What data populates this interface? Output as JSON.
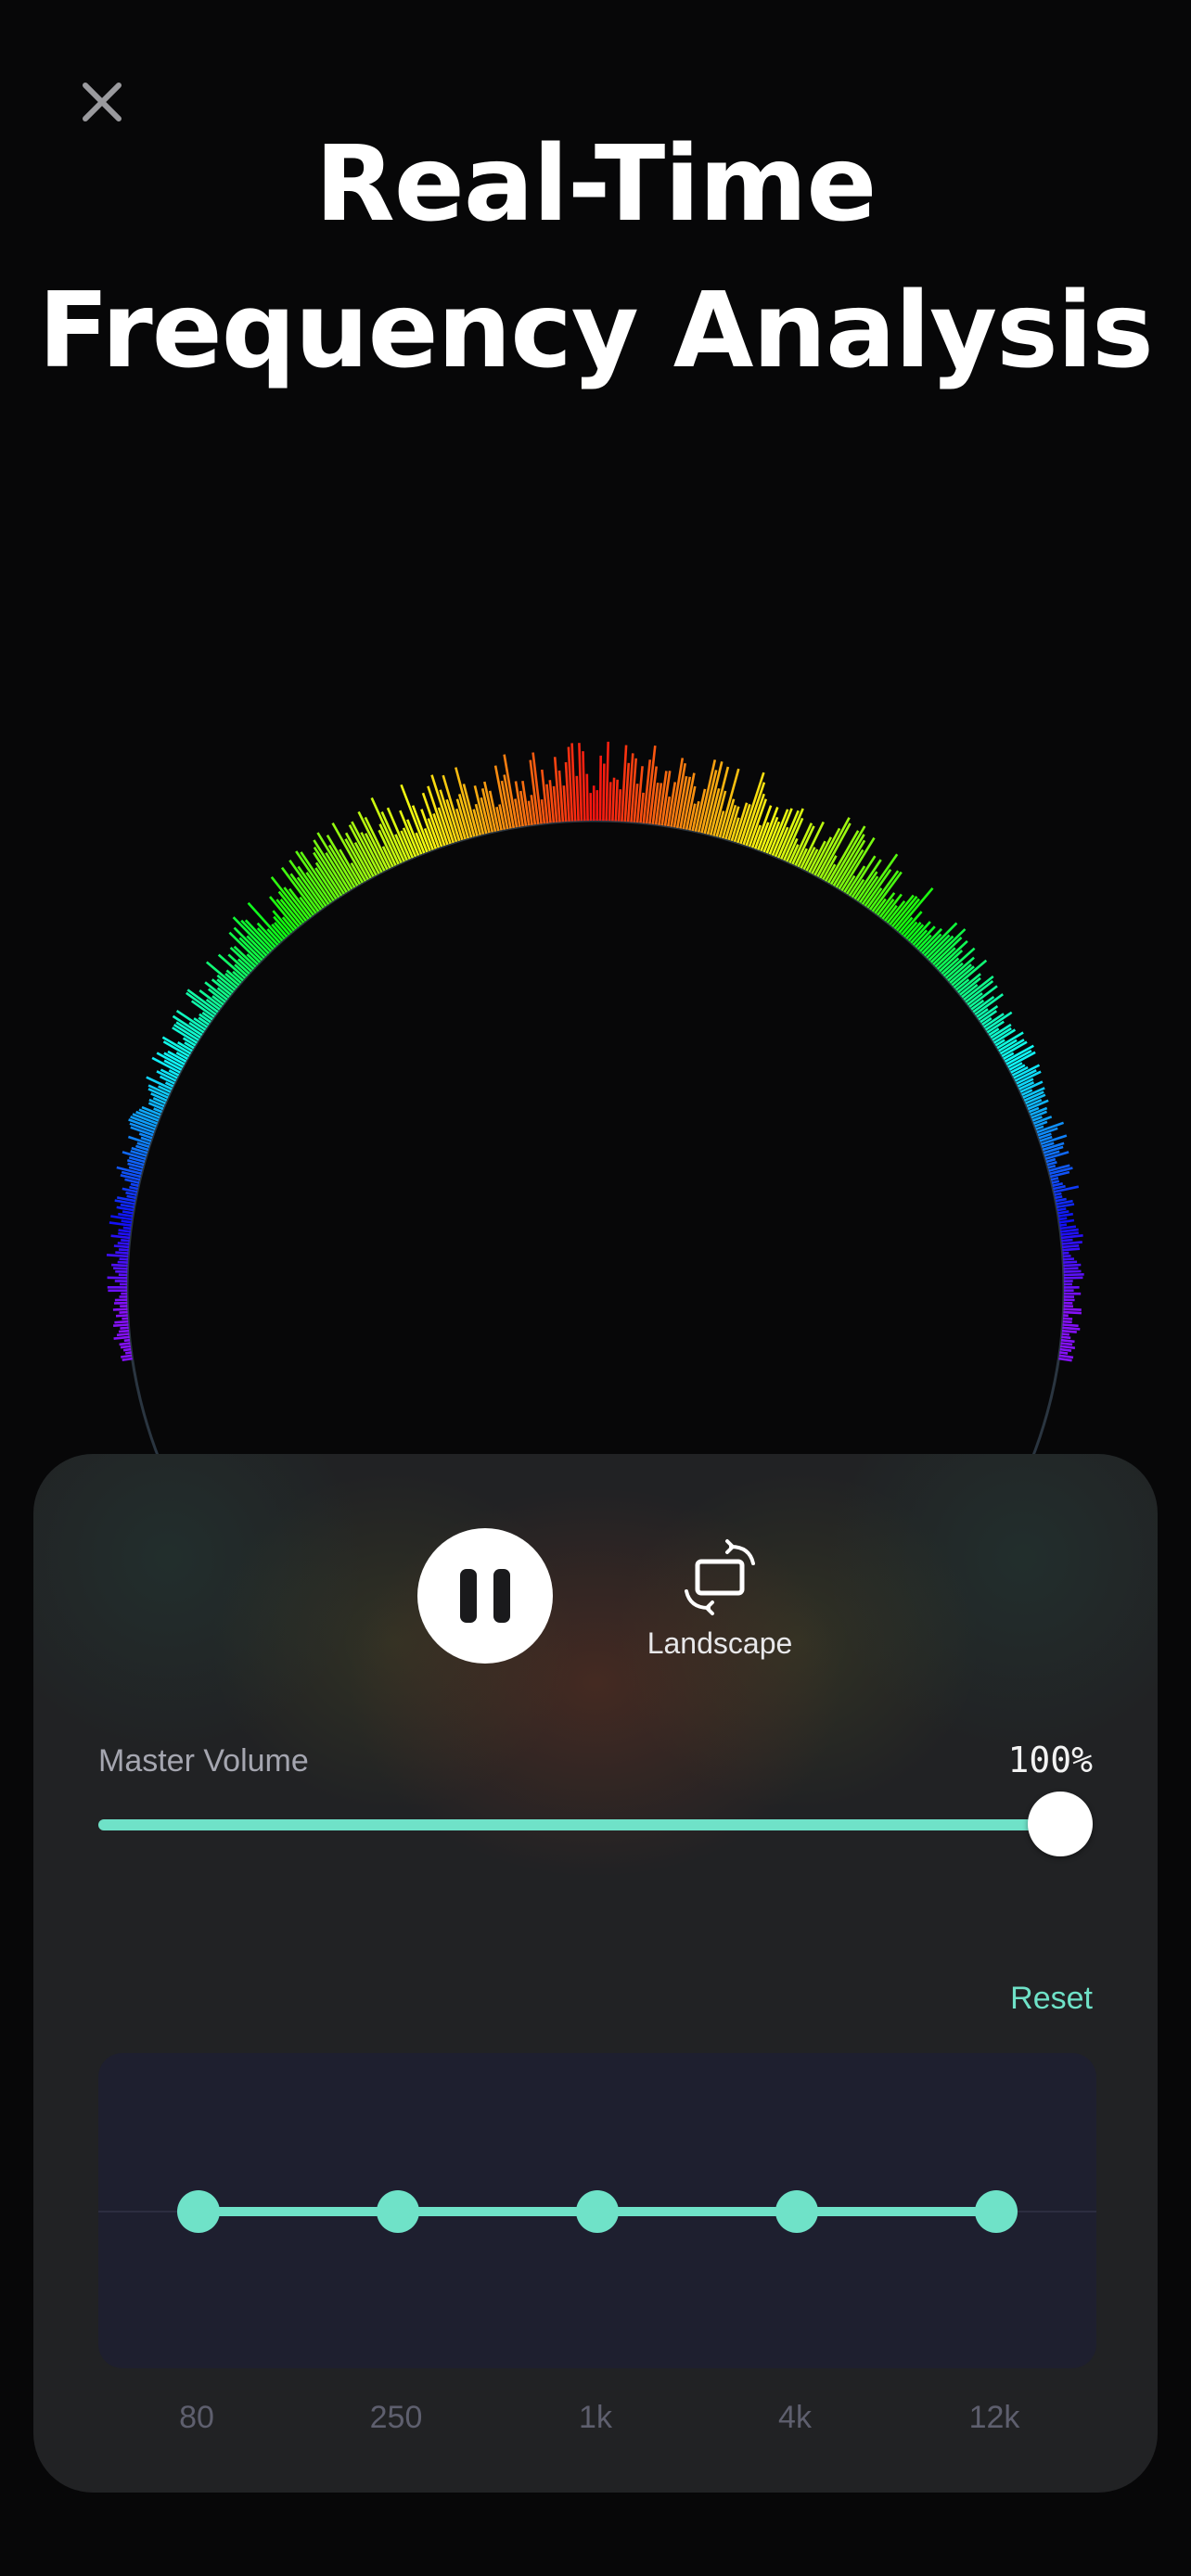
{
  "header": {
    "close_icon": "close-icon",
    "title_line1": "Real-Time",
    "title_line2": "Frequency Analysis"
  },
  "controls": {
    "pause_icon": "pause-icon",
    "landscape_icon": "rotate-screen-icon",
    "landscape_label": "Landscape"
  },
  "volume": {
    "label": "Master Volume",
    "value_text": "100%",
    "value": 1.0
  },
  "equalizer": {
    "reset_label": "Reset",
    "bands": [
      {
        "label": "80",
        "gain": 0
      },
      {
        "label": "250",
        "gain": 0
      },
      {
        "label": "1k",
        "gain": 0
      },
      {
        "label": "4k",
        "gain": 0
      },
      {
        "label": "12k",
        "gain": 0
      }
    ]
  },
  "colors": {
    "accent": "#6fe2c8",
    "background": "#070708",
    "panel": "#212224"
  }
}
